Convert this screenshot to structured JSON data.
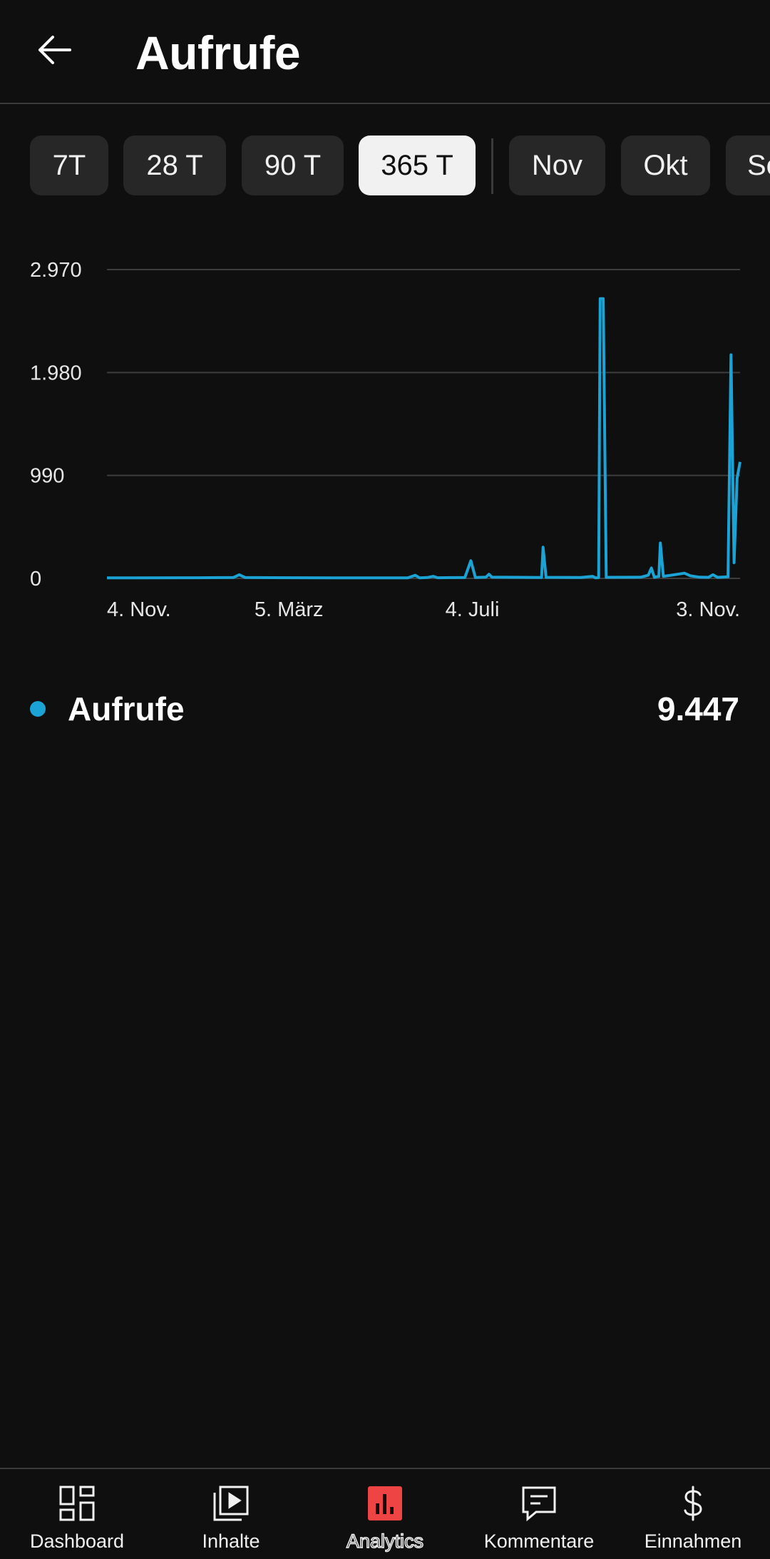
{
  "header": {
    "title": "Aufrufe",
    "back_icon": "arrow-left-icon"
  },
  "chips": [
    {
      "label": "7T",
      "active": false
    },
    {
      "label": "28 T",
      "active": false
    },
    {
      "label": "90 T",
      "active": false
    },
    {
      "label": "365 T",
      "active": true
    },
    {
      "label": "Nov",
      "active": false
    },
    {
      "label": "Okt",
      "active": false
    },
    {
      "label": "Se",
      "active": false
    }
  ],
  "chart_data": {
    "type": "line",
    "title": "",
    "xlabel": "",
    "ylabel": "",
    "ylim": [
      0,
      2970
    ],
    "yticks": [
      "2.970",
      "1.980",
      "990",
      "0"
    ],
    "ytick_values": [
      2970,
      1980,
      990,
      0
    ],
    "xticks": [
      "4. Nov.",
      "5. März",
      "4. Juli",
      "3. Nov."
    ],
    "xtick_days": [
      0,
      121,
      243,
      365
    ],
    "grid": true,
    "color": "#1aa3d4",
    "series": [
      {
        "name": "Aufrufe",
        "points": [
          [
            0,
            5
          ],
          [
            20,
            5
          ],
          [
            60,
            6
          ],
          [
            84,
            8
          ],
          [
            88,
            35
          ],
          [
            92,
            8
          ],
          [
            150,
            5
          ],
          [
            200,
            5
          ],
          [
            205,
            30
          ],
          [
            208,
            5
          ],
          [
            213,
            8
          ],
          [
            217,
            20
          ],
          [
            220,
            6
          ],
          [
            238,
            8
          ],
          [
            242,
            170
          ],
          [
            245,
            8
          ],
          [
            252,
            12
          ],
          [
            254,
            40
          ],
          [
            256,
            12
          ],
          [
            275,
            10
          ],
          [
            289,
            8
          ],
          [
            290,
            300
          ],
          [
            292,
            10
          ],
          [
            315,
            8
          ],
          [
            323,
            20
          ],
          [
            325,
            5
          ],
          [
            327,
            8
          ],
          [
            328,
            2690
          ],
          [
            330,
            2690
          ],
          [
            332,
            10
          ],
          [
            355,
            12
          ],
          [
            360,
            30
          ],
          [
            362,
            100
          ],
          [
            364,
            10
          ],
          [
            367,
            20
          ],
          [
            368,
            340
          ],
          [
            370,
            20
          ],
          [
            375,
            30
          ],
          [
            384,
            50
          ],
          [
            388,
            25
          ],
          [
            394,
            12
          ],
          [
            400,
            10
          ],
          [
            403,
            35
          ],
          [
            406,
            10
          ],
          [
            413,
            15
          ],
          [
            415,
            2150
          ],
          [
            417,
            150
          ],
          [
            419,
            960
          ],
          [
            421,
            1120
          ]
        ]
      }
    ],
    "legend": {
      "label": "Aufrufe",
      "value": "9.447",
      "placement": "bottom-left"
    }
  },
  "nav": [
    {
      "label": "Dashboard",
      "icon": "dashboard-icon",
      "active": false
    },
    {
      "label": "Inhalte",
      "icon": "content-icon",
      "active": false
    },
    {
      "label": "Analytics",
      "icon": "analytics-icon",
      "active": true
    },
    {
      "label": "Kommentare",
      "icon": "comments-icon",
      "active": false
    },
    {
      "label": "Einnahmen",
      "icon": "dollar-icon",
      "active": false
    }
  ]
}
